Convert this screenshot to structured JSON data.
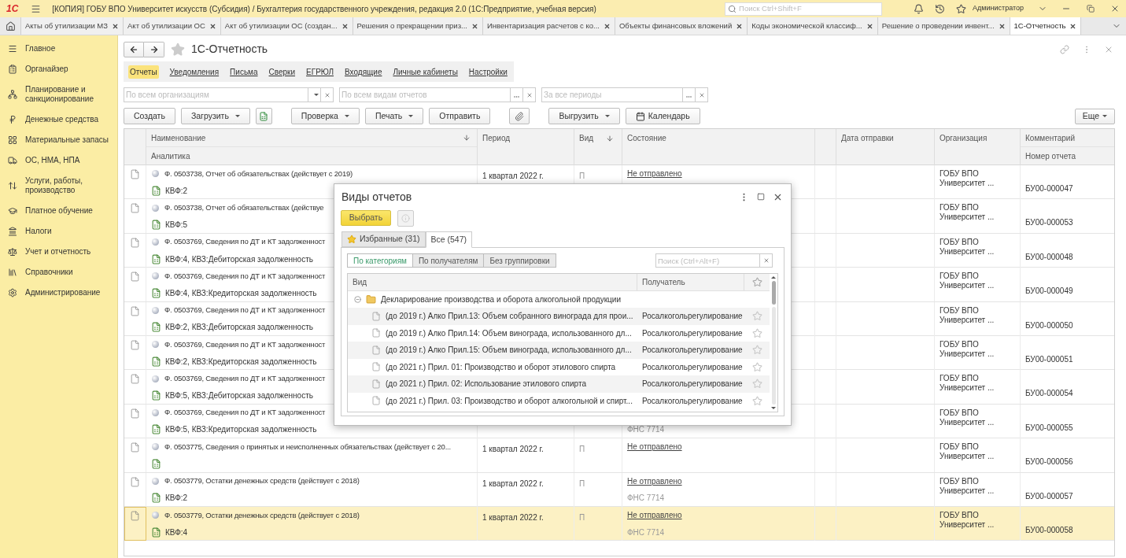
{
  "window": {
    "logo": "1С",
    "title": "[КОПИЯ] ГОБУ ВПО Университет искусств (Субсидия) / Бухгалтерия государственного учреждения, редакция 2.0  (1С:Предприятие, учебная версия)",
    "search_placeholder": "Поиск Ctrl+Shift+F",
    "user": "Администратор"
  },
  "open_tabs": [
    {
      "label": "Акты об утилизации МЗ",
      "selected": false
    },
    {
      "label": "Акт об утилизации ОС",
      "selected": false
    },
    {
      "label": "Акт об утилизации ОС (создан...",
      "selected": false
    },
    {
      "label": "Решения о прекращении приз...",
      "selected": false
    },
    {
      "label": "Инвентаризация расчетов с ко...",
      "selected": false
    },
    {
      "label": "Объекты финансовых вложений",
      "selected": false
    },
    {
      "label": "Коды экономической классиф...",
      "selected": false
    },
    {
      "label": "Решение о проведении инвент...",
      "selected": false
    },
    {
      "label": "1С-Отчетность",
      "selected": true
    }
  ],
  "sidebar": {
    "items": [
      {
        "label": "Главное"
      },
      {
        "label": "Органайзер"
      },
      {
        "label": "Планирование и санкционирование"
      },
      {
        "label": "Денежные средства"
      },
      {
        "label": "Материальные запасы"
      },
      {
        "label": "ОС, НМА, НПА"
      },
      {
        "label": "Услуги, работы, производство"
      },
      {
        "label": "Платное обучение"
      },
      {
        "label": "Налоги"
      },
      {
        "label": "Учет и отчетность"
      },
      {
        "label": "Справочники"
      },
      {
        "label": "Администрирование"
      }
    ]
  },
  "form": {
    "title": "1С-Отчетность",
    "sections": [
      {
        "label": "Отчеты",
        "selected": true
      },
      {
        "label": "Уведомления",
        "selected": false
      },
      {
        "label": "Письма",
        "selected": false
      },
      {
        "label": "Сверки",
        "selected": false
      },
      {
        "label": "ЕГРЮЛ",
        "selected": false
      },
      {
        "label": "Входящие",
        "selected": false
      },
      {
        "label": "Личные кабинеты",
        "selected": false
      },
      {
        "label": "Настройки",
        "selected": false
      }
    ],
    "filters": [
      {
        "kind": "dropdown",
        "placeholder": "По всем организациям"
      },
      {
        "kind": "choice",
        "placeholder": "По всем видам отчетов"
      },
      {
        "kind": "choice",
        "placeholder": "За все периоды"
      }
    ],
    "toolbar": [
      {
        "kind": "button",
        "label": "Создать"
      },
      {
        "kind": "menu",
        "label": "Загрузить"
      },
      {
        "kind": "export"
      },
      {
        "kind": "menu",
        "label": "Проверка"
      },
      {
        "kind": "menu",
        "label": "Печать"
      },
      {
        "kind": "button",
        "label": "Отправить"
      },
      {
        "kind": "attach"
      },
      {
        "kind": "menu",
        "label": "Выгрузить"
      },
      {
        "kind": "calendar",
        "label": "Календарь"
      }
    ],
    "more": "Еще",
    "table": {
      "columns": [
        {
          "label": "Наименование",
          "sorted": true
        },
        {
          "label": "Период",
          "sorted": false
        },
        {
          "label": "Вид",
          "sorted": true
        },
        {
          "label": "Состояние",
          "sorted": false
        },
        {
          "label": "Дата отправки",
          "sorted": false
        },
        {
          "label": "Организация",
          "sorted": false
        },
        {
          "label": "Комментарий",
          "sorted": false
        }
      ],
      "subcolumns": [
        "Аналитика",
        "Номер отчета"
      ],
      "rows": [
        {
          "name": "Ф. 0503738, Отчет об обязательствах (действует с 2019)",
          "analytics": "КВФ:2",
          "period": "1 квартал 2022 г.",
          "type": "П",
          "state": "Не отправлено",
          "organization": "ГОБУ ВПО Университет ...",
          "number": "БУ00-000047",
          "selected": false
        },
        {
          "name": "Ф. 0503738, Отчет об обязательствах (действуе",
          "analytics": "КВФ:5",
          "organization": "ГОБУ ВПО Университет ...",
          "number": "БУ00-000053",
          "selected": false
        },
        {
          "name": "Ф. 0503769, Сведения по ДТ и КТ задолженност",
          "analytics": "КВФ:4, КВЗ:Дебиторская задолженность",
          "organization": "ГОБУ ВПО Университет ...",
          "number": "БУ00-000048",
          "selected": false
        },
        {
          "name": "Ф. 0503769, Сведения по ДТ и КТ задолженност",
          "analytics": "КВФ:4, КВЗ:Кредиторская задолженность",
          "organization": "ГОБУ ВПО Университет ...",
          "number": "БУ00-000049",
          "selected": false
        },
        {
          "name": "Ф. 0503769, Сведения по ДТ и КТ задолженност",
          "analytics": "КВФ:2, КВЗ:Дебиторская задолженность",
          "organization": "ГОБУ ВПО Университет ...",
          "number": "БУ00-000050",
          "selected": false
        },
        {
          "name": "Ф. 0503769, Сведения по ДТ и КТ задолженност",
          "analytics": "КВФ:2, КВЗ:Кредиторская задолженность",
          "organization": "ГОБУ ВПО Университет ...",
          "number": "БУ00-000051",
          "selected": false
        },
        {
          "name": "Ф. 0503769, Сведения по ДТ и КТ задолженност",
          "analytics": "КВФ:5, КВЗ:Дебиторская задолженность",
          "organization": "ГОБУ ВПО Университет ...",
          "number": "БУ00-000054",
          "selected": false
        },
        {
          "name": "Ф. 0503769, Сведения по ДТ и КТ задолженност",
          "analytics": "КВФ:5, КВЗ:Кредиторская задолженность",
          "recipient": "ФНС 7714",
          "organization": "ГОБУ ВПО Университет ...",
          "number": "БУ00-000055",
          "selected": false
        },
        {
          "name": "Ф. 0503775, Сведения о принятых и неисполненных обязательствах (действует с 20...",
          "period": "1 квартал 2022 г.",
          "type": "П",
          "state": "Не отправлено",
          "organization": "ГОБУ ВПО Университет ...",
          "number": "БУ00-000056",
          "selected": false
        },
        {
          "name": "Ф. 0503779, Остатки денежных средств (действует с 2018)",
          "analytics": "КВФ:2",
          "period": "1 квартал 2022 г.",
          "type": "П",
          "state": "Не отправлено",
          "recipient": "ФНС 7714",
          "organization": "ГОБУ ВПО Университет ...",
          "number": "БУ00-000057",
          "selected": false
        },
        {
          "name": "Ф. 0503779, Остатки денежных средств (действует с 2018)",
          "analytics": "КВФ:4",
          "period": "1 квартал 2022 г.",
          "type": "П",
          "state": "Не отправлено",
          "recipient": "ФНС 7714",
          "organization": "ГОБУ ВПО Университет ...",
          "number": "БУ00-000058",
          "selected": true
        }
      ]
    }
  },
  "dialog": {
    "title": "Виды отчетов",
    "select_button": "Выбрать",
    "tabs": [
      {
        "label": "Избранные (31)",
        "selected": false
      },
      {
        "label": "Все (547)",
        "selected": true
      }
    ],
    "grouping": [
      {
        "label": "По категориям",
        "selected": true
      },
      {
        "label": "По получателям",
        "selected": false
      },
      {
        "label": "Без группировки",
        "selected": false
      }
    ],
    "search_placeholder": "Поиск (Ctrl+Alt+F)",
    "columns": [
      "Вид",
      "Получатель"
    ],
    "group": {
      "label": "Декларирование производства и оборота алкогольной продукции",
      "expanded": true,
      "children": [
        {
          "label": "(до 2019 г.) Алко Прил.13: Объем собранного винограда для прои...",
          "recipient": "Росалкогольрегулирование",
          "favorite": false
        },
        {
          "label": "(до 2019 г.) Алко Прил.14: Объем винограда, использованного дл...",
          "recipient": "Росалкогольрегулирование",
          "favorite": false
        },
        {
          "label": "(до 2019 г.) Алко Прил.15: Объем винограда, использованного дл...",
          "recipient": "Росалкогольрегулирование",
          "favorite": false
        },
        {
          "label": "(до 2021 г.) Прил. 01: Производство и оборот этилового спирта",
          "recipient": "Росалкогольрегулирование",
          "favorite": false
        },
        {
          "label": "(до 2021 г.) Прил. 02: Использование этилового спирта",
          "recipient": "Росалкогольрегулирование",
          "favorite": false
        },
        {
          "label": "(до 2021 г.) Прил. 03: Производство и оборот алкогольной и спирт...",
          "recipient": "Росалкогольрегулирование",
          "favorite": false
        }
      ]
    }
  }
}
